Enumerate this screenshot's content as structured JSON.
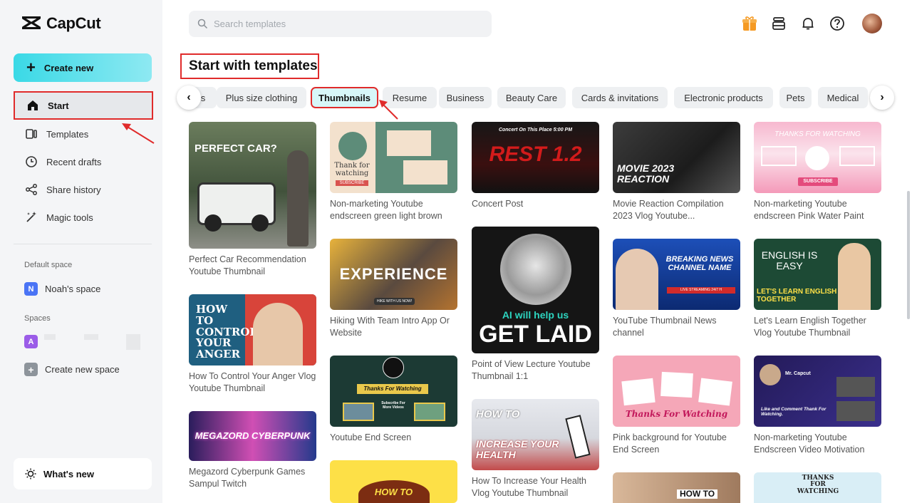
{
  "app": {
    "brand": "CapCut"
  },
  "sidebar": {
    "create_label": "Create new",
    "nav": [
      {
        "label": "Start",
        "icon": "home-icon"
      },
      {
        "label": "Templates",
        "icon": "templates-icon"
      },
      {
        "label": "Recent drafts",
        "icon": "clock-icon"
      },
      {
        "label": "Share history",
        "icon": "share-icon"
      },
      {
        "label": "Magic tools",
        "icon": "magic-wand-icon"
      }
    ],
    "default_space_label": "Default space",
    "default_space": {
      "initial": "N",
      "name": "Noah's space"
    },
    "spaces_label": "Spaces",
    "space": {
      "initial": "A"
    },
    "create_space": {
      "icon": "+",
      "label": "Create new space"
    },
    "whats_new_label": "What's new"
  },
  "search": {
    "placeholder": "Search templates"
  },
  "main": {
    "title": "Start with templates",
    "chips": [
      "s",
      "Plus size clothing",
      "Thumbnails",
      "Resume",
      "Business",
      "Beauty Care",
      "Cards & invitations",
      "Electronic products",
      "Pets",
      "Medical"
    ],
    "selected_chip": "Thumbnails"
  },
  "cards": [
    {
      "caption": "Perfect Car Recommendation Youtube Thumbnail",
      "thumb_text": "PERFECT CAR?"
    },
    {
      "caption": "How To Control Your Anger Vlog Youtube Thumbnail",
      "thumb_text": "HOW TO CONTROL YOUR ANGER"
    },
    {
      "caption": "Megazord Cyberpunk Games Sampul Twitch",
      "thumb_text": "MEGAZORD CYBERPUNK"
    },
    {
      "caption": "Non-marketing Youtube endscreen green light brown",
      "thumb_text": "Thank for watching",
      "thumb_sub": "SUBSCRIBE"
    },
    {
      "caption": "Hiking With Team Intro App Or Website",
      "thumb_text": "EXPERIENCE",
      "thumb_sub": "HIKE WITH US NOW!"
    },
    {
      "caption": "Youtube End Screen",
      "thumb_text": "Thanks For Watching",
      "thumb_sub": "Subscribe For More Videos"
    },
    {
      "caption": "",
      "thumb_text": "HOW TO"
    },
    {
      "caption": "Concert Post",
      "thumb_text": "Concert On This Place 5:00 PM",
      "thumb_sub": "REST 1.2"
    },
    {
      "caption": "Point of View Lecture Youtube Thumbnail 1:1",
      "thumb_text": "AI will help us",
      "thumb_sub": "GET LAID"
    },
    {
      "caption": "How To Increase Your Health Vlog Youtube Thumbnail",
      "thumb_text": "HOW TO",
      "thumb_sub": "INCREASE YOUR HEALTH"
    },
    {
      "caption": "Movie Reaction Compilation 2023 Vlog Youtube...",
      "thumb_text": "MOVIE 2023 REACTION"
    },
    {
      "caption": "YouTube Thumbnail News channel",
      "thumb_text": "BREAKING NEWS CHANNEL NAME",
      "thumb_sub": "LIVE STREAMING 24/7 H"
    },
    {
      "caption": "Pink background for Youtube End Screen",
      "thumb_text": "Thanks For Watching"
    },
    {
      "caption": "",
      "thumb_text": "HOW TO"
    },
    {
      "caption": "Non-marketing Youtube endscreen Pink Water Paint",
      "thumb_text": "THANKS FOR WATCHING",
      "thumb_sub": "SUBSCRIBE"
    },
    {
      "caption": "Let's Learn English Together Vlog Youtube Thumbnail",
      "thumb_text": "ENGLISH IS EASY",
      "thumb_sub": "LET'S LEARN ENGLISH TOGETHER"
    },
    {
      "caption": "Non-marketing Youtube Endscreen Video Motivation",
      "thumb_text": "Mr. Capcut",
      "thumb_sub": "Like and Comment Thank For Watching."
    },
    {
      "caption": "",
      "thumb_text": "THANKS FOR WATCHING"
    }
  ],
  "colors": {
    "accent": "#3ad9e6",
    "highlight": "#e02b2b",
    "sidebar_bg": "#f4f5f7"
  }
}
